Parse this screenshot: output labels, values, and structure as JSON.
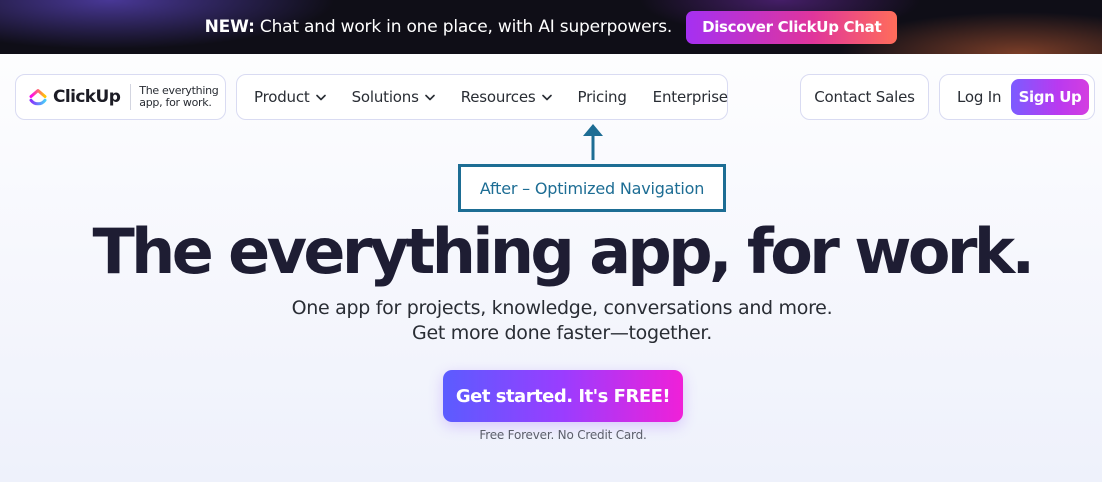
{
  "banner": {
    "prefix": "NEW:",
    "text": " Chat and work in one place, with AI superpowers.",
    "button": "Discover ClickUp Chat"
  },
  "logo": {
    "wordmark": "ClickUp",
    "tagline": "The everything app, for work."
  },
  "nav": {
    "items": [
      {
        "label": "Product",
        "dropdown": true
      },
      {
        "label": "Solutions",
        "dropdown": true
      },
      {
        "label": "Resources",
        "dropdown": true
      },
      {
        "label": "Pricing",
        "dropdown": false
      },
      {
        "label": "Enterprise",
        "dropdown": false
      }
    ],
    "contact_sales": "Contact Sales",
    "log_in": "Log In",
    "sign_up": "Sign Up"
  },
  "annotation": {
    "label": "After – Optimized Navigation",
    "color": "#1d6d94"
  },
  "hero": {
    "title": "The everything app, for work.",
    "subtitle_line1": "One app for projects, knowledge, conversations and more.",
    "subtitle_line2": "Get more done faster—together.",
    "cta": "Get started. It's FREE!",
    "cta_note": "Free Forever. No Credit Card."
  },
  "icons": {
    "logo": "clickup-logo-icon",
    "dropdown": "chevron-down-icon",
    "annotation_arrow": "arrow-up-icon"
  }
}
